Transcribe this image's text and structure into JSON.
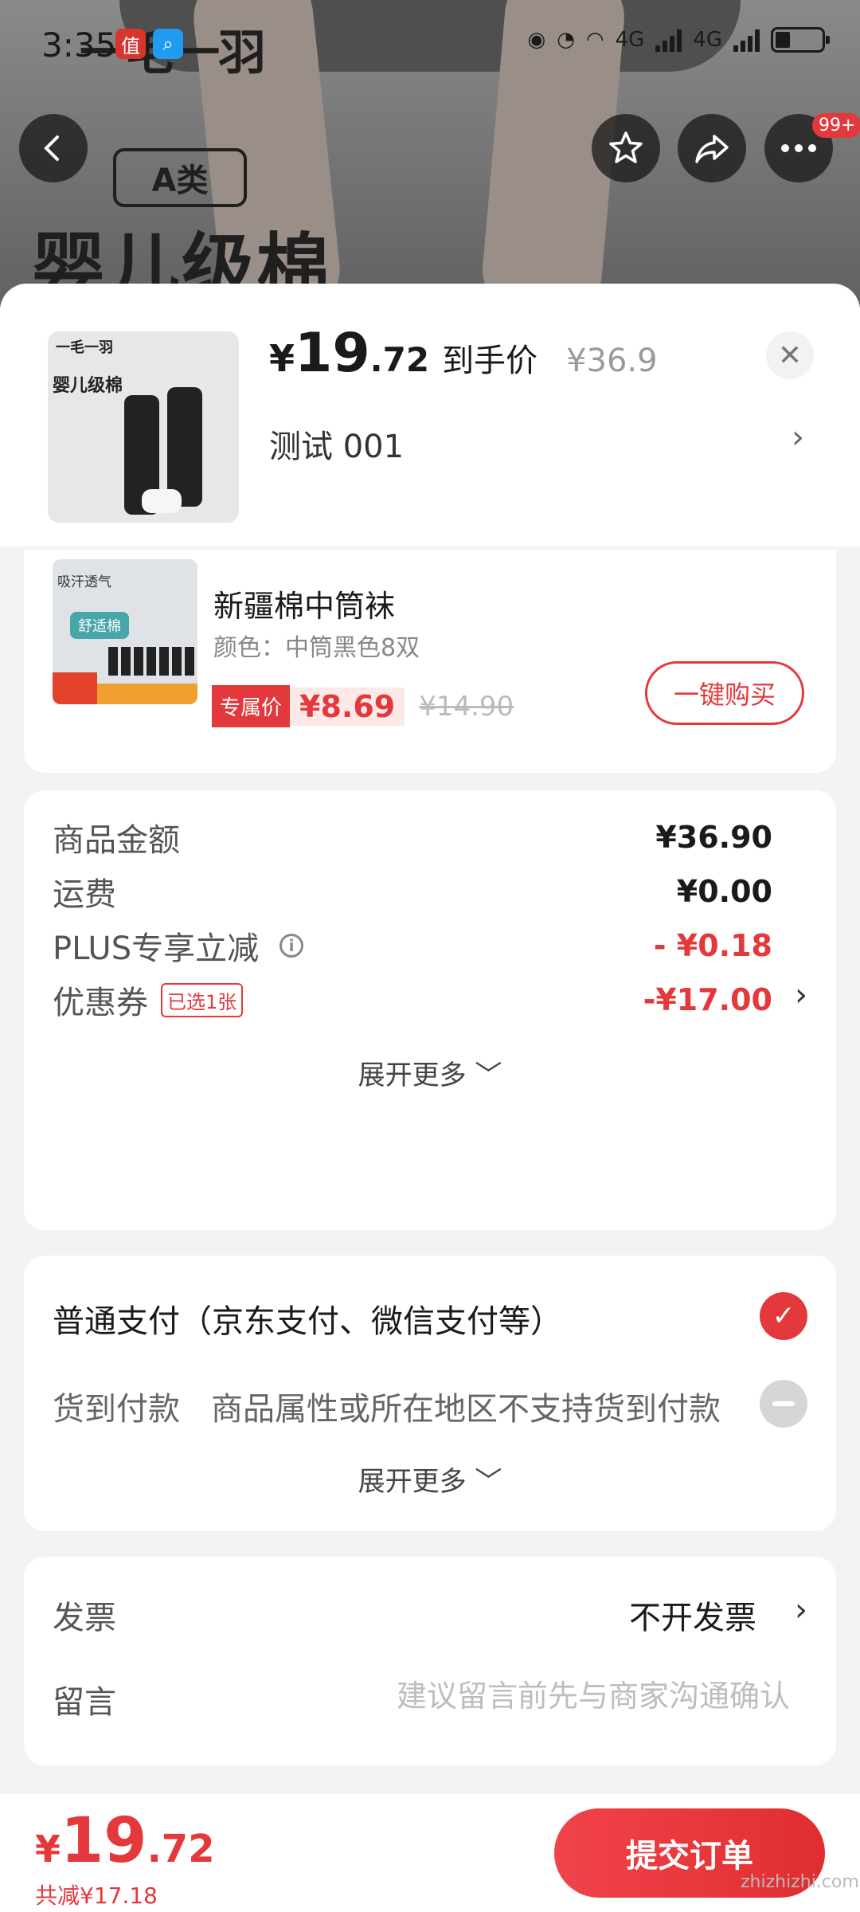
{
  "status": {
    "time": "3:35",
    "network": "4G",
    "network2": "4G"
  },
  "background": {
    "brand": "一毛一羽",
    "grade": "A类",
    "headline": "婴儿级棉"
  },
  "header": {
    "badge": "99+"
  },
  "product": {
    "price_cur": "¥",
    "price_int": "19",
    "price_dec": ".72",
    "price_label": "到手价",
    "original_price": "¥36.9",
    "spec": "测试  001",
    "thumb_brand": "一毛一羽",
    "thumb_headline": "婴儿级棉"
  },
  "recommend": {
    "name": "新疆棉中筒袜",
    "attr": "颜色：中筒黑色8双",
    "price_tag": "专属价",
    "price": "¥8.69",
    "original": "¥14.90",
    "buy_label": "一键购买",
    "img_tag1": "吸汗透气",
    "img_tag2": "舒适棉"
  },
  "cost": {
    "rows": [
      {
        "label": "商品金额",
        "value": "¥36.90"
      },
      {
        "label": "运费",
        "value": "¥0.00"
      },
      {
        "label": "PLUS专享立减",
        "value": "- ¥0.18"
      },
      {
        "label": "优惠券",
        "tag": "已选1张",
        "value": "-¥17.00"
      }
    ],
    "expand": "展开更多 ﹀"
  },
  "payment": {
    "normal": "普通支付（京东支付、微信支付等）",
    "cod_label": "货到付款",
    "cod_note": "商品属性或所在地区不支持货到付款",
    "expand": "展开更多 ﹀"
  },
  "invoice": {
    "label": "发票",
    "value": "不开发票",
    "message_label": "留言",
    "message_placeholder": "建议留言前先与商家沟通确认"
  },
  "footer": {
    "total_cur": "¥",
    "total_int": "19",
    "total_dec": ".72",
    "saved": "共减¥17.18",
    "submit": "提交订单"
  },
  "watermark": "zhizhizhi.com",
  "colors": {
    "accent": "#e4393c"
  },
  "icons": [
    "back-icon",
    "star-icon",
    "share-icon",
    "more-icon",
    "close-icon",
    "chevron-right-icon",
    "info-icon",
    "check-icon",
    "disabled-icon"
  ]
}
